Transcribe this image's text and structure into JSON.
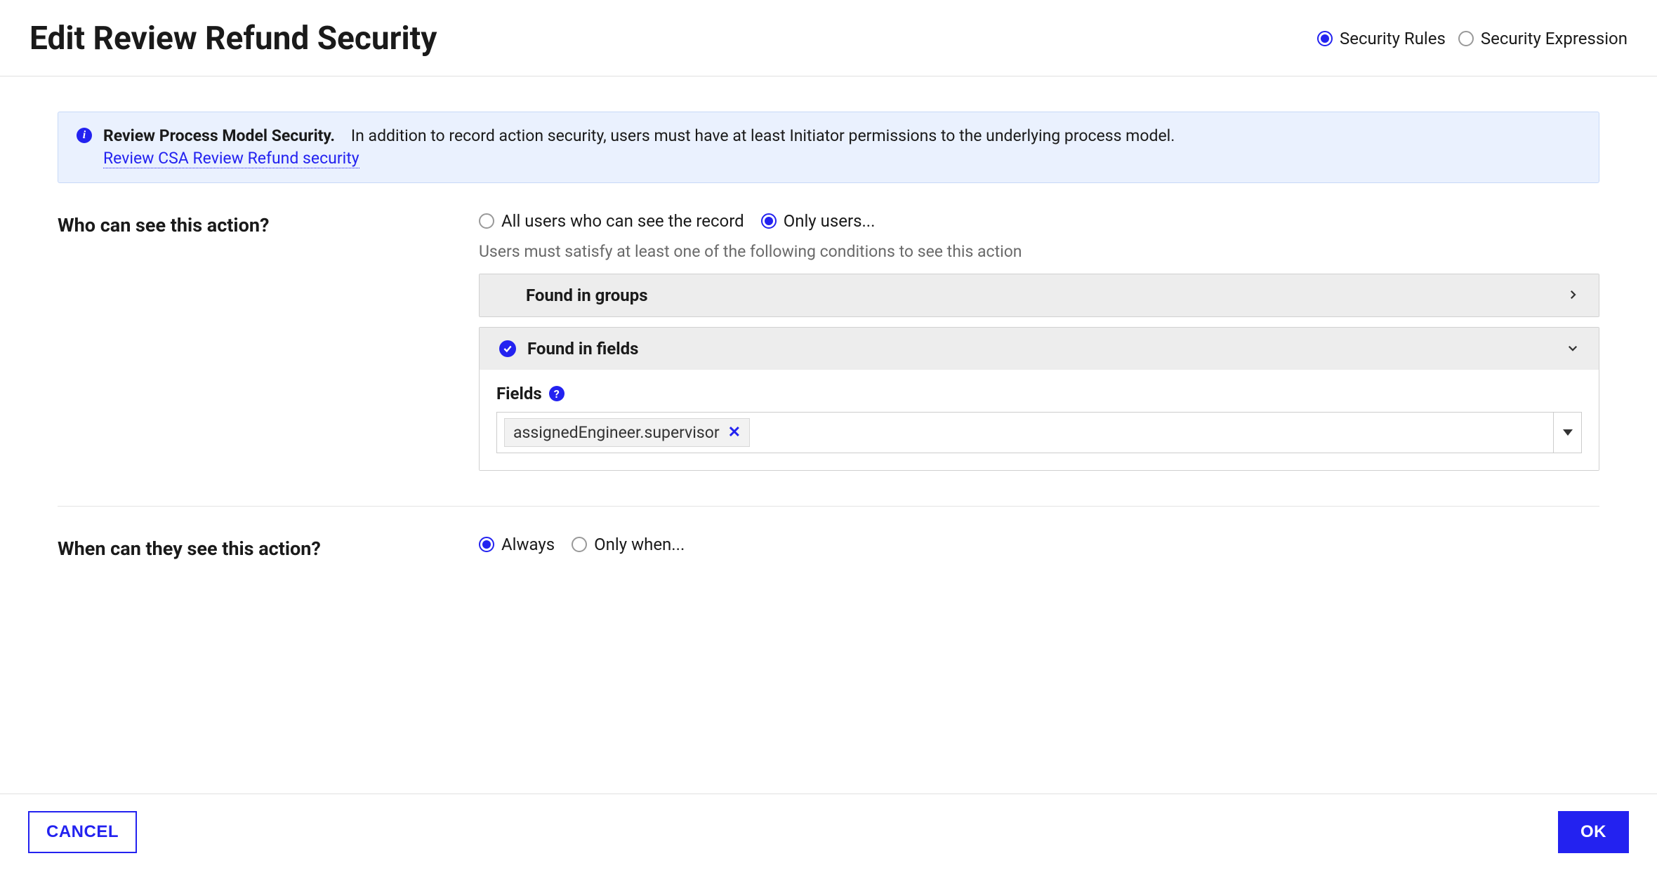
{
  "header": {
    "title": "Edit Review Refund Security",
    "mode_radios": {
      "rules": {
        "label": "Security Rules",
        "selected": true
      },
      "expression": {
        "label": "Security Expression",
        "selected": false
      }
    }
  },
  "banner": {
    "title": "Review Process Model Security.",
    "body": "In addition to record action security, users must have at least Initiator permissions to the underlying process model.",
    "link": "Review CSA Review Refund security"
  },
  "who": {
    "label": "Who can see this action?",
    "options": {
      "all": {
        "label": "All users who can see the record",
        "selected": false
      },
      "only": {
        "label": "Only users...",
        "selected": true
      }
    },
    "helper": "Users must satisfy at least one of the following conditions to see this action",
    "groups_panel": {
      "title": "Found in groups",
      "expanded": false
    },
    "fields_panel": {
      "title": "Found in fields",
      "expanded": true,
      "completed": true,
      "fields_label": "Fields",
      "tokens": [
        "assignedEngineer.supervisor"
      ]
    }
  },
  "when": {
    "label": "When can they see this action?",
    "options": {
      "always": {
        "label": "Always",
        "selected": true
      },
      "only": {
        "label": "Only when...",
        "selected": false
      }
    }
  },
  "footer": {
    "cancel": "CANCEL",
    "ok": "OK"
  }
}
